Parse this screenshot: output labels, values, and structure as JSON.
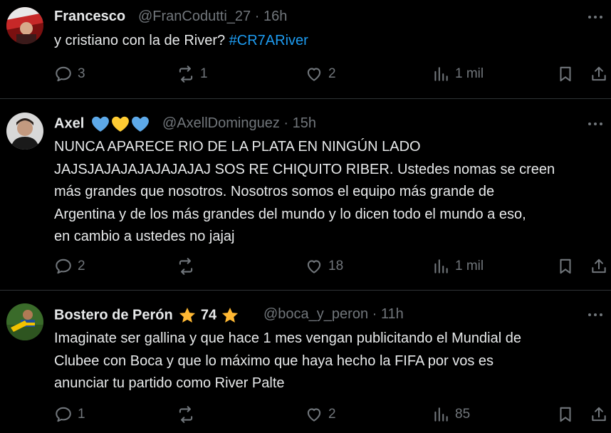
{
  "tweets": [
    {
      "name": "Francesco",
      "handle": "@FranCodutti_27",
      "sep": "·",
      "time": "16h",
      "text": "y cristiano con la de River?",
      "hashtag": "#CR7ARiver",
      "replies": "3",
      "retweets": "1",
      "likes": "2",
      "views": "1 mil",
      "avatar_colors": [
        "#9c1c1c",
        "#d9d9d9"
      ]
    },
    {
      "name": "Axel",
      "badges": [
        "blue-heart",
        "yellow-heart",
        "blue-heart"
      ],
      "handle": "@AxellDominguez",
      "sep": "·",
      "time": "15h",
      "text_lines": [
        "NUNCA APARECE RIO DE LA PLATA EN NINGÚN LADO",
        "JAJSJAJAJAJAJAJAJAJ SOS RE CHIQUITO RIBER. Ustedes nomas se creen",
        "más grandes que nosotros. Nosotros somos el equipo más grande de",
        "Argentina y de los más grandes del mundo y lo dicen todo el mundo a eso,",
        "en cambio a ustedes no jajaj"
      ],
      "replies": "2",
      "retweets": "",
      "likes": "18",
      "views": "1 mil",
      "avatar_colors": [
        "#3a3a3a",
        "#c9c9c9"
      ]
    },
    {
      "name": "Bostero de Perón",
      "name_star_count": "74",
      "badges": [
        "star",
        "star"
      ],
      "handle": "@boca_y_peron",
      "sep": "·",
      "time": "11h",
      "text_lines": [
        "Imaginate ser gallina y que hace 1 mes vengan publicitando el Mundial de",
        "Clubee con Boca y que lo máximo que haya hecho la FIFA por vos es",
        "anunciar tu partido como River Palte"
      ],
      "replies": "1",
      "retweets": "",
      "likes": "2",
      "views": "85",
      "avatar_colors": [
        "#1f4f9a",
        "#f2c200"
      ]
    }
  ],
  "colors": {
    "background": "#000000",
    "text": "#e7e9ea",
    "muted": "#71767b",
    "link": "#1d9bf0",
    "divider": "#2f3336",
    "heart_blue": "#5da9e9",
    "heart_yellow": "#ffcc33",
    "star": "#ffb833"
  }
}
